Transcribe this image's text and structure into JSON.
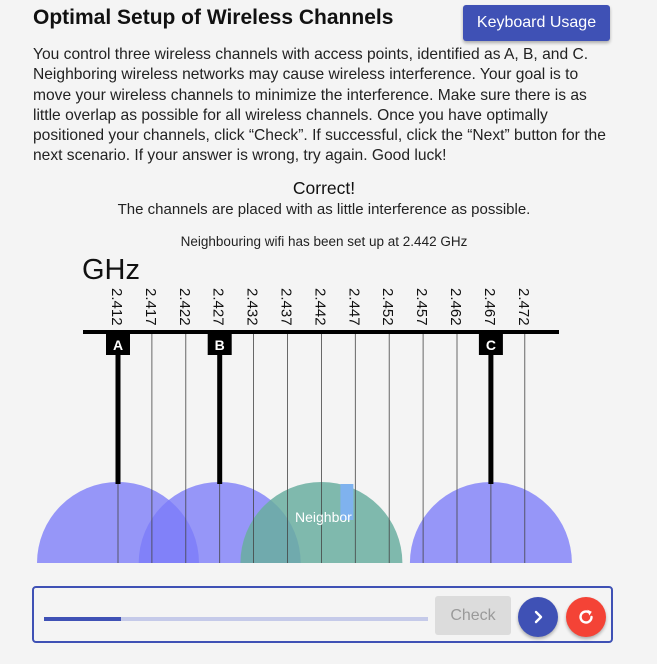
{
  "header": {
    "title": "Optimal Setup of Wireless Channels",
    "keyboard_button": "Keyboard Usage"
  },
  "instructions": "You control three wireless channels with access points, identified as A, B, and C. Neighboring wireless networks may cause wireless interference. Your goal is to move your wireless channels to minimize the interference. Make sure there is as little overlap as possible for all wireless channels. Once you have optimally positioned your channels, click “Check”. If successful, click the “Next” button for the next scenario. If your answer is wrong, try again. Good luck!",
  "result": {
    "title": "Correct!",
    "detail": "The channels are placed with as little interference as possible."
  },
  "neighbour_info": "Neighbouring wifi has been set up at 2.442 GHz",
  "channel_chart": {
    "unit_label": "GHz",
    "frequencies": [
      "2.412",
      "2.417",
      "2.422",
      "2.427",
      "2.432",
      "2.437",
      "2.442",
      "2.447",
      "2.452",
      "2.457",
      "2.462",
      "2.467",
      "2.472"
    ],
    "access_points": [
      {
        "label": "A",
        "frequency": 2.412
      },
      {
        "label": "B",
        "frequency": 2.427
      },
      {
        "label": "C",
        "frequency": 2.467
      }
    ],
    "neighbor": {
      "label": "Neighbor",
      "frequency": 2.442
    },
    "colors": {
      "access_point": "#7b7bf8",
      "neighbor": "#6aaea0",
      "marker": "#000000",
      "neighbor_marker": "#7fb2ee"
    }
  },
  "controls": {
    "progress": 0.2,
    "check_label": "Check",
    "next_icon": "chevron-right-icon",
    "reset_icon": "refresh-icon"
  }
}
